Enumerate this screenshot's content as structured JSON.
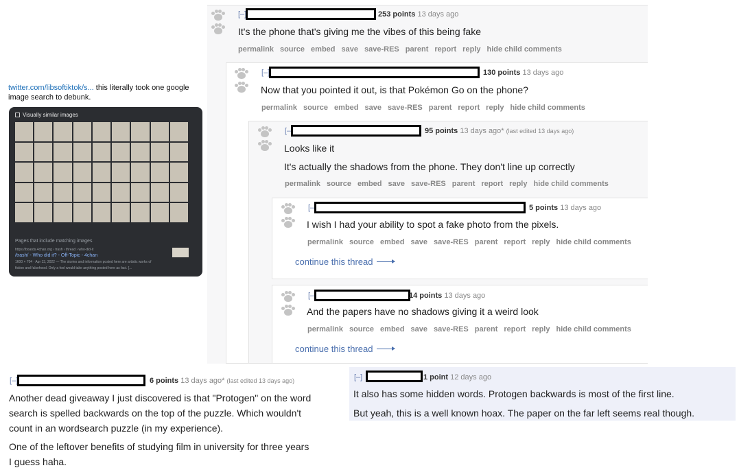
{
  "tweet": {
    "link": "twitter.com/libsoftiktok/s...",
    "text": " this literally took one google image search to debunk."
  },
  "lens": {
    "header": "Visually similar images",
    "pages_label": "Pages that include matching images",
    "url": "https://boards.4chan.org › trash › thread › who-did-it",
    "title": "/trash/ - Who did it? - Off-Topic - 4chan",
    "desc1": "1600 × 704 · Apr 13, 2022 — The stories and information posted here are artistic works of",
    "desc2": "fiction and falsehood. Only a fool would take anything posted here as fact. [..."
  },
  "common_links": [
    "permalink",
    "source",
    "embed",
    "save",
    "save-RES",
    "parent",
    "report",
    "reply",
    "hide child comments"
  ],
  "comments": [
    {
      "collapse": "[–]",
      "score": "253 points",
      "time": "13 days ago",
      "body": "It's the phone that's giving me the vibes of this being fake"
    },
    {
      "collapse": "[–]",
      "score": "130 points",
      "time": "13 days ago",
      "body": "Now that you pointed it out, is that Pokémon Go on the phone?"
    },
    {
      "collapse": "[–]",
      "score": "95 points",
      "time": "13 days ago*",
      "edited": "(last edited 13 days ago)",
      "body": "Looks like it",
      "body2": "It's actually the shadows from the phone. They don't line up correctly"
    },
    {
      "collapse": "[–]",
      "score": "5 points",
      "time": "13 days ago",
      "body": "I wish I had your ability to spot a fake photo from the pixels.",
      "continue": "continue this thread"
    },
    {
      "collapse": "[–]",
      "score": "14 points",
      "time": "13 days ago",
      "body": "And the papers have no shadows giving it a weird look",
      "continue": "continue this thread"
    }
  ],
  "bottom_left": {
    "collapse": "[–]",
    "score": "6 points",
    "time": "13 days ago*",
    "edited": "(last edited 13 days ago)",
    "p1_l1": "Another dead giveaway I just discovered is that \"Protogen\" on the word",
    "p1_l2": "search is spelled backwards on the top of the puzzle. Which wouldn't",
    "p1_l3": "count in an wordsearch puzzle (in my experience).",
    "p2_l1": "One of the leftover benefits of studying film in university for three years",
    "p2_l2": "I guess haha."
  },
  "bottom_right": {
    "collapse": "[–]",
    "score": "1 point",
    "time": "12 days ago",
    "p1": "It also has some hidden words. Protogen backwards is most of the first line.",
    "p2": "But yeah, this is a well known hoax. The paper on the far left seems real though."
  }
}
